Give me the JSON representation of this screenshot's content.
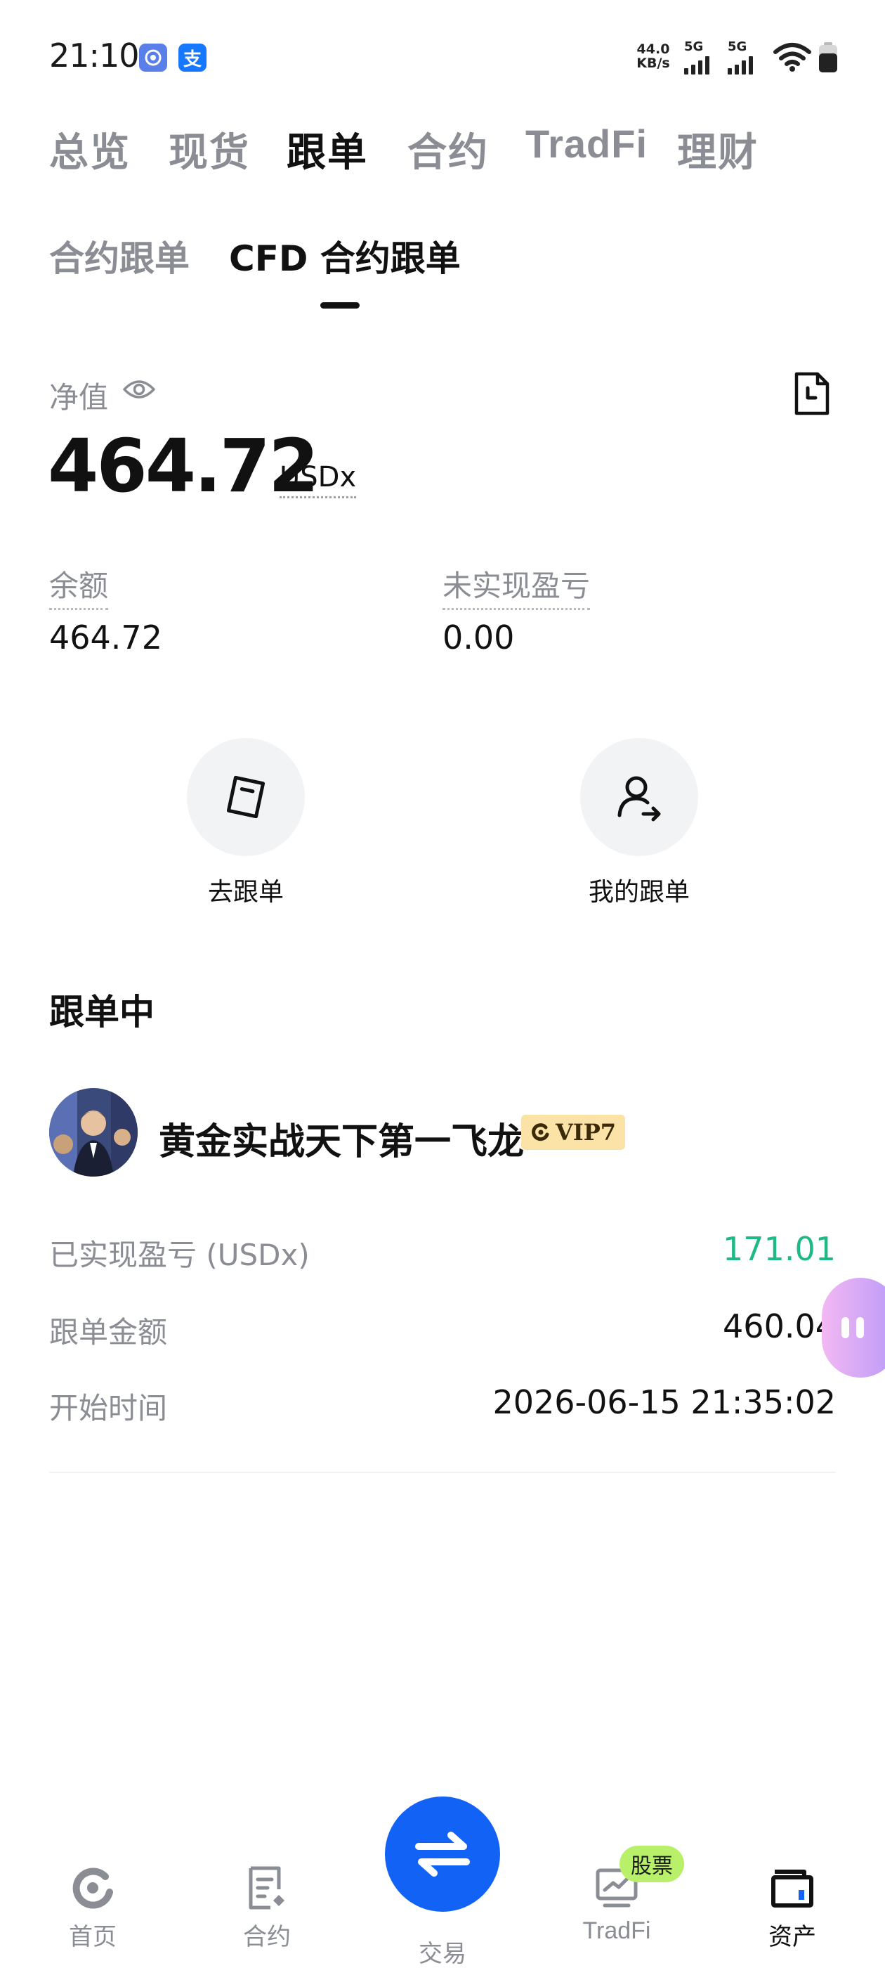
{
  "status_bar": {
    "time": "21:10",
    "speed_value": "44.0",
    "speed_unit": "KB/s",
    "net1": "5G",
    "net2": "5G"
  },
  "top_tabs": [
    "总览",
    "现货",
    "跟单",
    "合约",
    "TradFi",
    "理财"
  ],
  "sub_tabs": [
    "合约跟单",
    "CFD 合约跟单"
  ],
  "equity": {
    "label": "净值",
    "value": "464.72",
    "unit": "USDx"
  },
  "balance": {
    "label": "余额",
    "value": "464.72"
  },
  "unrealized": {
    "label": "未实现盈亏",
    "value": "0.00"
  },
  "actions": {
    "go_copy": "去跟单",
    "my_copy": "我的跟单"
  },
  "section_title": "跟单中",
  "trader": {
    "name": "黄金实战天下第一飞龙",
    "vip": "VIP7",
    "realized_label": "已实现盈亏 (USDx)",
    "realized_value": "171.01",
    "amount_label": "跟单金额",
    "amount_value": "460.04",
    "start_label": "开始时间",
    "start_value": "2026-06-15 21:35:02"
  },
  "bottom_nav": {
    "home": "首页",
    "contract": "合约",
    "trade": "交易",
    "tradfi": "TradFi",
    "tradfi_badge": "股票",
    "assets": "资产"
  },
  "colors": {
    "accent_blue": "#1263f5",
    "profit_green": "#1fb986",
    "muted_text": "#8a8d93",
    "vip_bg": "#fbe3a8",
    "badge_green": "#b8f06a"
  }
}
